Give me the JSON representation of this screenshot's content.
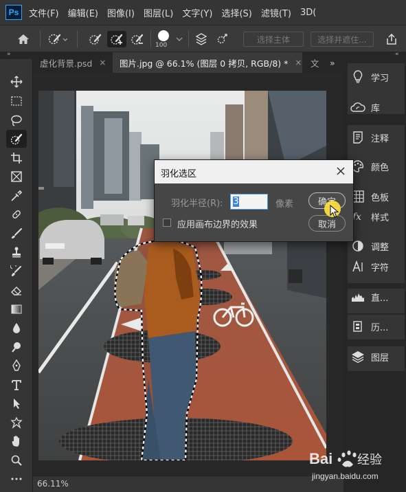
{
  "app": {
    "logo_text": "Ps",
    "menu": [
      "文件(F)",
      "编辑(E)",
      "图像(I)",
      "图层(L)",
      "文字(Y)",
      "选择(S)",
      "滤镜(T)",
      "3D("
    ]
  },
  "options_bar": {
    "brush_size": "100",
    "select_subject_label": "选择主体",
    "select_and_mask_label": "选择并遮住..."
  },
  "tabs": [
    {
      "label": "虚化背景.psd",
      "active": false
    },
    {
      "label": "图片.jpg @ 66.1% (图层 0 拷贝, RGB/8) *",
      "active": true
    },
    {
      "label": "文",
      "active": false
    }
  ],
  "status": {
    "zoom": "66.11%"
  },
  "right_panel": {
    "items": [
      "学习",
      "库",
      "注释",
      "颜色",
      "色板",
      "样式",
      "调整",
      "字符",
      "直...",
      "历...",
      "图层"
    ]
  },
  "dialog": {
    "title": "羽化选区",
    "radius_label": "羽化半径(R):",
    "radius_value": "3",
    "unit": "像素",
    "ok_label": "确定",
    "cancel_label": "取消",
    "checkbox_label": "应用画布边界的效果",
    "checkbox_checked": false
  },
  "watermark": {
    "brand": "Baidu经验",
    "url": "jingyan.baidu.com"
  },
  "colors": {
    "accent": "#31a8ff",
    "lane": "#a9553a",
    "cursor": "#ffe13c"
  }
}
